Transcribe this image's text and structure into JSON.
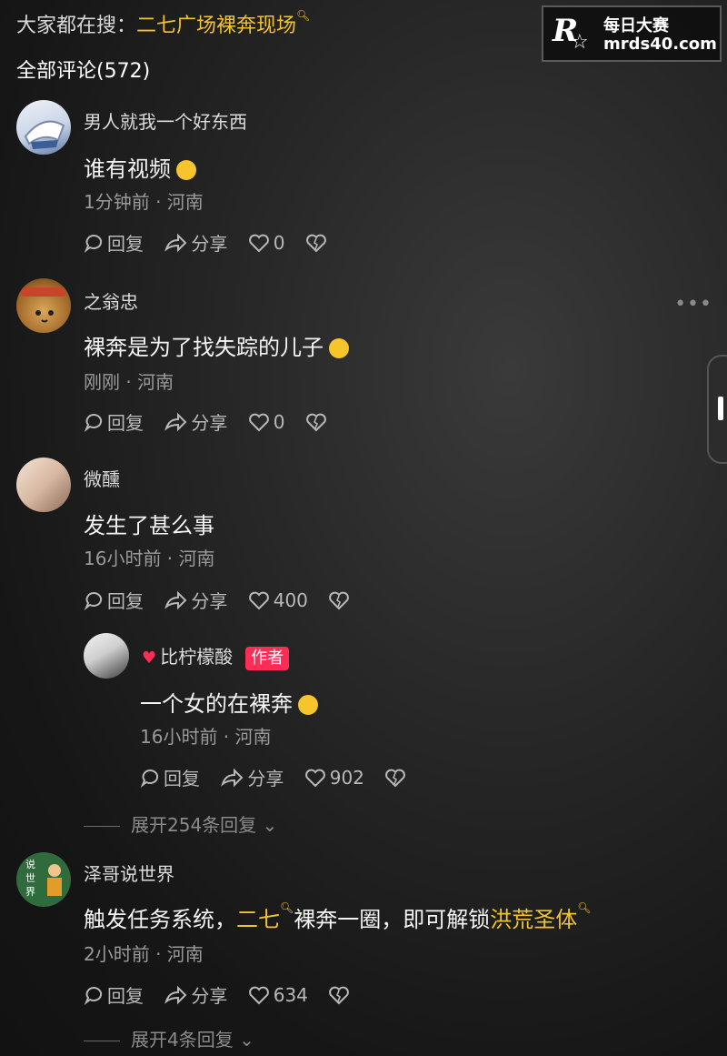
{
  "hot_search": {
    "prefix": "大家都在搜：",
    "keyword": "二七广场裸奔现场"
  },
  "comment_count_label": "全部评论(572)",
  "watermark": {
    "line1": "每日大赛",
    "line2": "mrds40.com",
    "logo_letter": "R"
  },
  "action_labels": {
    "reply": "回复",
    "share": "分享"
  },
  "comments": [
    {
      "username": "男人就我一个好东西",
      "text": "谁有视频",
      "emoji": "laughing-crying",
      "time_location": "1分钟前 · 河南",
      "likes": "0"
    },
    {
      "username": "之翁忠",
      "text": "裸奔是为了找失踪的儿子",
      "emoji": "loudly-crying",
      "time_location": "刚刚 · 河南",
      "likes": "0"
    },
    {
      "username": "微醺",
      "text": "发生了甚么事",
      "time_location": "16小时前 · 河南",
      "likes": "400"
    },
    {
      "username": "比柠檬酸",
      "author_tag": "作者",
      "text": "一个女的在裸奔",
      "emoji": "laughing-crying",
      "time_location": "16小时前 · 河南",
      "likes": "902"
    },
    {
      "username": "泽哥说世界",
      "avatar_text": [
        "说",
        "世",
        "界"
      ],
      "text_part1": "触发任务系统，",
      "keyword1": "二七",
      "text_part2": "裸奔一圈，即可解锁",
      "keyword2": "洪荒圣体",
      "time_location": "2小时前 · 河南",
      "likes": "634"
    }
  ],
  "expand_replies": [
    "展开254条回复",
    "展开4条回复"
  ],
  "colors": {
    "keyword": "#f2c230",
    "author_tag": "#ff2d55",
    "background": "#1c1c1c"
  }
}
